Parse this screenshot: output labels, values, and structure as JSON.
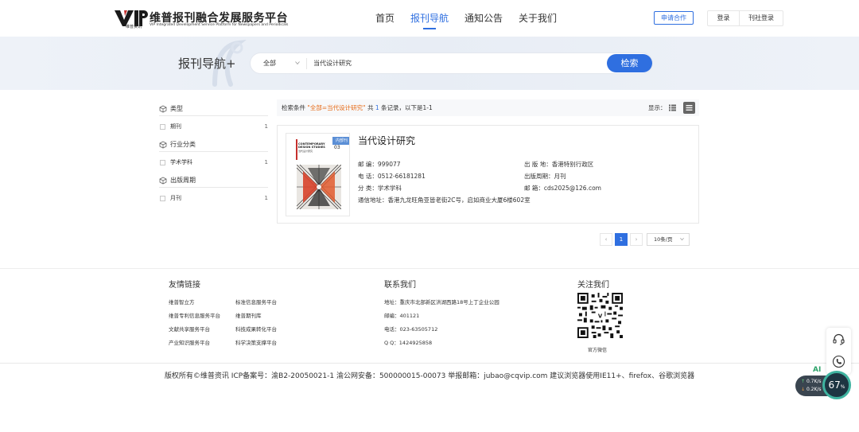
{
  "header": {
    "logo_text": "维普报刊融合发展服务平台",
    "logo_sub": "VIP Integrated Development Service Platform for Newspapers and Periodicals",
    "logo_cn_small": "维普资讯",
    "nav": [
      "首页",
      "报刊导航",
      "通知公告",
      "关于我们"
    ],
    "active_nav": "报刊导航",
    "apply_label": "申请合作",
    "login_label": "登录",
    "journal_login_label": "刊社登录"
  },
  "banner": {
    "title": "报刊导航+",
    "search_scope": "全部",
    "search_value": "当代设计研究",
    "search_button": "检索"
  },
  "filters": [
    {
      "title": "类型",
      "items": [
        {
          "label": "期刊",
          "count": "1"
        }
      ]
    },
    {
      "title": "行业分类",
      "items": [
        {
          "label": "学术学科",
          "count": "1"
        }
      ]
    },
    {
      "title": "出版周期",
      "items": [
        {
          "label": "月刊",
          "count": "1"
        }
      ]
    }
  ],
  "results": {
    "cond_prefix": "检索条件",
    "cond_query": "\"全部=当代设计研究\"",
    "cond_mid": "共",
    "cond_count": "1",
    "cond_suffix": "条记录，以下是1-1",
    "view_label": "显示：",
    "items": [
      {
        "badge": "内部刊",
        "cover_title1": "CONTEMPORARY",
        "cover_title2": "DESIGN STUDIES",
        "cover_issue": "03",
        "cover_sub": "当代设计研究",
        "title": "当代设计研究",
        "postcode": "邮      编：999077",
        "publish_place": "出  版  地：香港特别行政区",
        "phone": "电      话：0512-66181281",
        "cycle": "出版周期：月刊",
        "category": "分      类：学术学科",
        "email": "邮      箱：cds2025@126.com",
        "address": "通信地址：香港九龙旺角亚皆老街2C号，启如商业大厦6楼602室"
      }
    ]
  },
  "pager": {
    "prev": "‹",
    "current": "1",
    "next": "›",
    "page_size": "10条/页"
  },
  "footer": {
    "links_title": "友情链接",
    "links": [
      "维普智立方",
      "标准信息服务平台",
      "维普专利信息服务平台",
      "维普期刊库",
      "文献共享服务平台",
      "科技成果转化平台",
      "产业知识服务平台",
      "科学决策支撑平台"
    ],
    "contact_title": "联系我们",
    "contact": [
      "地址：重庆市北部新区洪湖西路18号上丁企业公园",
      "邮编：401121",
      "电话：023-63505712",
      "Q Q：1424925858"
    ],
    "follow_title": "关注我们",
    "qr_label": "官方微信",
    "copyright": "版权所有©维普资讯  ICP备案号：渝B2-20050021-1  渝公网安备：500000015-00073  举报邮箱：jubao@cqvip.com   建议浏览器使用IE11+、firefox、谷歌浏览器"
  },
  "widgets": {
    "ai_label": "AI",
    "speed_up": "0.7K/s",
    "speed_down": "0.2K/s",
    "percent": "67",
    "percent_unit": "%"
  },
  "colors": {
    "primary": "#2f6fe0",
    "highlight": "#e66a17"
  }
}
